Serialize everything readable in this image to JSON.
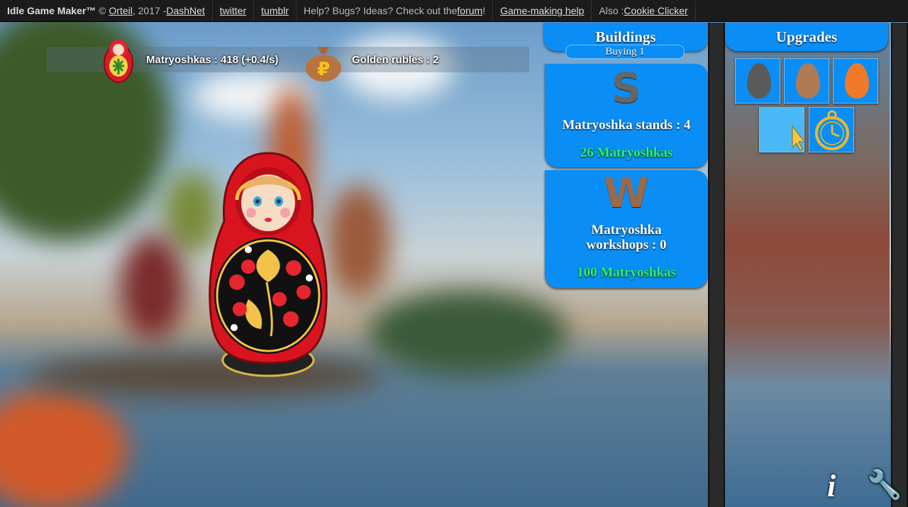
{
  "topbar": {
    "brand": "Idle Game Maker™",
    "copyright_prefix": "©",
    "author": "Orteil",
    "year_sep": ", 2017 - ",
    "org": "DashNet",
    "twitter": "twitter",
    "tumblr": "tumblr",
    "help_text": "Help? Bugs? Ideas? Check out the ",
    "forum": "forum",
    "help_end": "!",
    "game_making_help": "Game-making help",
    "also_prefix": "Also : ",
    "cookie_clicker": "Cookie Clicker"
  },
  "resources": {
    "matryoshkas": "Matryoshkas : 418 (+0.4/s)",
    "golden_rubles": "Golden rubles : 2"
  },
  "buildings": {
    "title": "Buildings",
    "buying": "Buying 1",
    "items": [
      {
        "letter": "S",
        "name": "Matryoshka stands : 4",
        "cost": "26 Matryoshkas"
      },
      {
        "letter": "W",
        "name_line1": "Matryoshka",
        "name_line2": "workshops : 0",
        "cost": "100 Matryoshkas"
      }
    ]
  },
  "upgrades": {
    "title": "Upgrades",
    "items": [
      {
        "icon": "grey-egg-icon",
        "color": "#5a5a5a"
      },
      {
        "icon": "brown-egg-icon",
        "color": "#b07a55"
      },
      {
        "icon": "orange-egg-icon",
        "color": "#f07a2a"
      },
      {
        "icon": "cursor-icon",
        "color": "#f5c542"
      },
      {
        "icon": "pocket-watch-icon",
        "color": "#e8b830"
      }
    ]
  },
  "corner": {
    "info_glyph": "i",
    "settings_glyph": "🔧"
  },
  "colors": {
    "panel_blue": "#0a8ef6",
    "cost_green": "#27f86a",
    "topbar_bg": "#1b1b1b"
  }
}
